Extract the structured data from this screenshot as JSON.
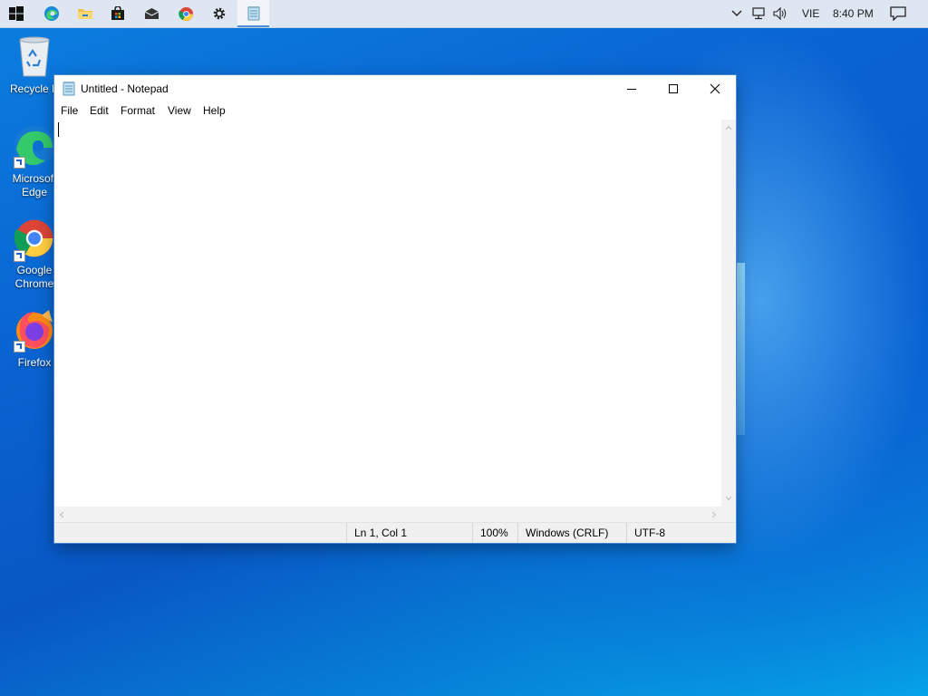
{
  "taskbar": {
    "items": [
      {
        "name": "Start",
        "icon": "windows-logo-icon"
      },
      {
        "name": "Microsoft Edge",
        "icon": "edge-icon"
      },
      {
        "name": "File Explorer",
        "icon": "folder-icon"
      },
      {
        "name": "Microsoft Store",
        "icon": "store-bag-icon"
      },
      {
        "name": "Mail",
        "icon": "mail-icon"
      },
      {
        "name": "Google Chrome",
        "icon": "chrome-icon"
      },
      {
        "name": "Settings",
        "icon": "gear-icon"
      },
      {
        "name": "Notepad",
        "icon": "notepad-icon",
        "active": true
      }
    ],
    "tray": {
      "language": "VIE",
      "time": "8:40 PM"
    }
  },
  "desktop": {
    "icons": [
      {
        "label_line1": "Recycle B",
        "label_line2": "",
        "icon": "recycle-bin-icon"
      },
      {
        "label_line1": "Microsoft",
        "label_line2": "Edge",
        "icon": "edge-icon"
      },
      {
        "label_line1": "Google",
        "label_line2": "Chrome",
        "icon": "chrome-icon"
      },
      {
        "label_line1": "Firefox",
        "label_line2": "",
        "icon": "firefox-icon"
      }
    ]
  },
  "notepad": {
    "title": "Untitled - Notepad",
    "menu": [
      "File",
      "Edit",
      "Format",
      "View",
      "Help"
    ],
    "content": "",
    "status": {
      "position": "Ln 1, Col 1",
      "zoom": "100%",
      "line_ending": "Windows (CRLF)",
      "encoding": "UTF-8"
    }
  },
  "colors": {
    "taskbar_bg": "#dde6f1",
    "desktop_blue": "#0a63d1",
    "window_border": "#4a88d0"
  }
}
